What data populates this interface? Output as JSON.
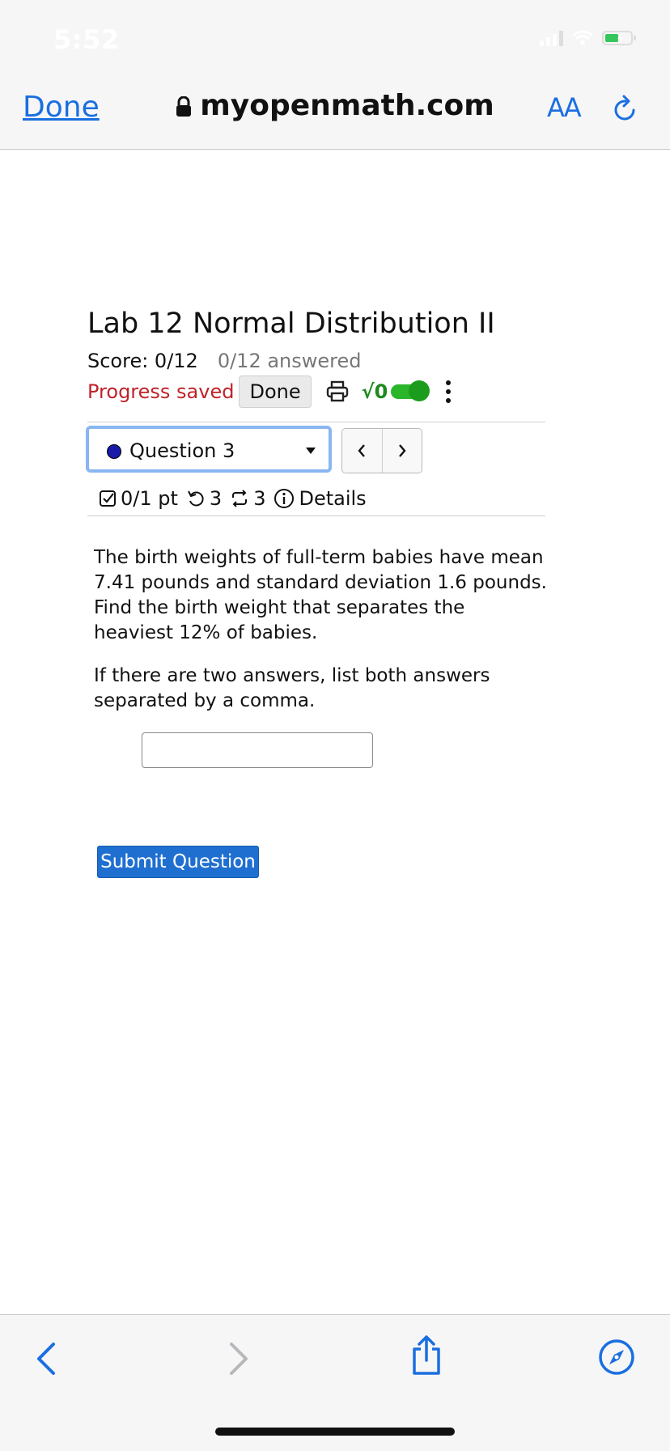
{
  "status_bar": {
    "time": "5:52"
  },
  "browser": {
    "done_label": "Done",
    "url": "myopenmath.com",
    "aa_label": "AA"
  },
  "assessment": {
    "title": "Lab 12 Normal Distribution II",
    "score": "Score: 0/12",
    "answered": "0/12 answered",
    "progress": "Progress saved",
    "done_button": "Done",
    "sqrt_label": "√0"
  },
  "question_nav": {
    "selected": "Question 3",
    "prev": "<",
    "next": ">"
  },
  "question_meta": {
    "points": "0/1 pt",
    "tries": "3",
    "regens": "3",
    "details": "Details"
  },
  "question": {
    "text1": "The birth weights of full-term babies have mean 7.41 pounds and standard deviation 1.6 pounds. Find the birth weight that separates the heaviest 12% of babies.",
    "text2": "If there are two answers, list both answers separated by a comma.",
    "answer_value": "",
    "submit_label": "Submit Question"
  },
  "colors": {
    "accent": "#1a6fe0",
    "progress": "#c0222a",
    "toggle": "#2bb52b",
    "submit": "#1f6fd1"
  }
}
